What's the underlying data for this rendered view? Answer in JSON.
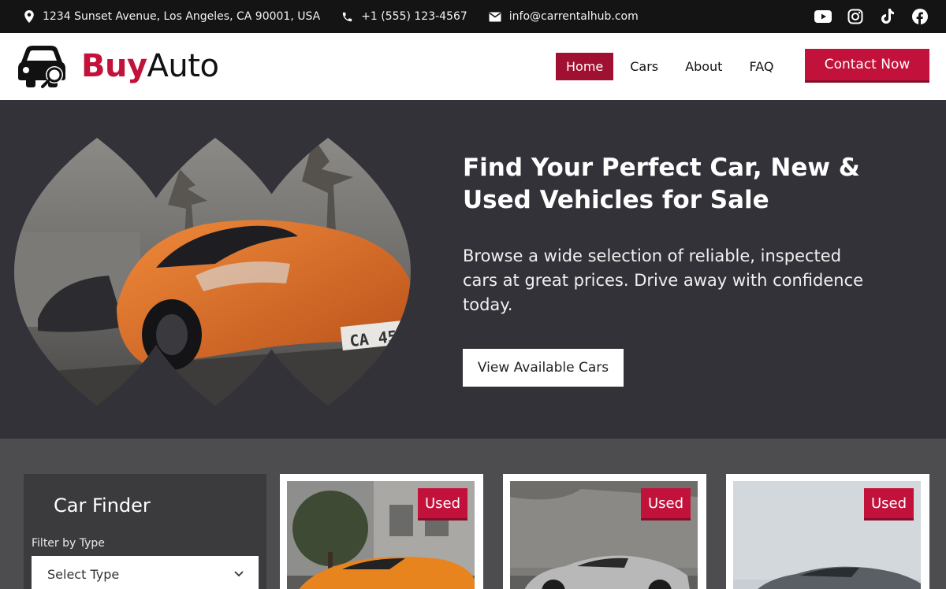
{
  "topbar": {
    "address": "1234 Sunset Avenue, Los Angeles, CA 90001, USA",
    "phone": "+1 (555) 123-4567",
    "email": "info@carrentalhub.com",
    "socials": [
      "youtube-icon",
      "instagram-icon",
      "tiktok-icon",
      "facebook-icon"
    ]
  },
  "header": {
    "logo_buy": "Buy",
    "logo_auto": "Auto",
    "nav": [
      "Home",
      "Cars",
      "About",
      "FAQ"
    ],
    "active_nav": "Home",
    "contact_label": "Contact Now"
  },
  "hero": {
    "title": "Find Your Perfect Car, New & Used Vehicles for Sale",
    "subtitle": "Browse a wide selection of reliable, inspected cars at great prices. Drive away with confidence today.",
    "cta_label": "View Available Cars"
  },
  "finder": {
    "title": "Car Finder",
    "filter_label": "Filter by Type",
    "select_value": "Select Type"
  },
  "cards": [
    {
      "badge": "Used",
      "car_color": "#e8841e"
    },
    {
      "badge": "Used",
      "car_color": "#b8b8b8"
    },
    {
      "badge": "Used",
      "car_color": "#5a5f66"
    }
  ],
  "colors": {
    "accent": "#c2123b",
    "accent_dark": "#a01030",
    "hero_bg": "#343239",
    "topbar_bg": "#141414"
  }
}
